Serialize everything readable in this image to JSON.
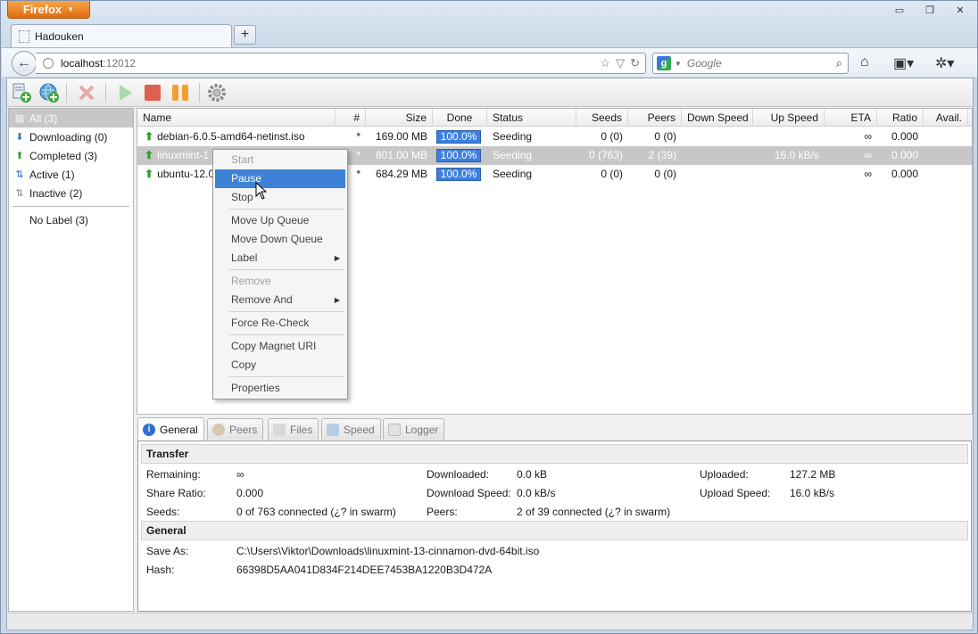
{
  "browser": {
    "menu_button": "Firefox",
    "tab_title": "Hadouken",
    "url_host": "localhost",
    "url_port": ":12012",
    "search_placeholder": "Google"
  },
  "sidebar": {
    "items": [
      {
        "label": "All (3)",
        "icon": "all-icon"
      },
      {
        "label": "Downloading (0)",
        "icon": "down-arrow-icon"
      },
      {
        "label": "Completed (3)",
        "icon": "up-arrow-icon"
      },
      {
        "label": "Active (1)",
        "icon": "active-icon"
      },
      {
        "label": "Inactive (2)",
        "icon": "inactive-icon"
      }
    ],
    "labels": [
      {
        "label": "No Label (3)"
      }
    ]
  },
  "table": {
    "columns": [
      "Name",
      "#",
      "Size",
      "Done",
      "Status",
      "Seeds",
      "Peers",
      "Down Speed",
      "Up Speed",
      "ETA",
      "Ratio",
      "Avail."
    ],
    "rows": [
      {
        "name": "debian-6.0.5-amd64-netinst.iso",
        "queue": "*",
        "size": "169.00 MB",
        "done": "100.0%",
        "status": "Seeding",
        "seeds": "0 (0)",
        "peers": "0 (0)",
        "down": "",
        "up": "",
        "eta": "∞",
        "ratio": "0.000",
        "avail": ""
      },
      {
        "name": "linuxmint-1",
        "queue": "*",
        "size": "801.00 MB",
        "done": "100.0%",
        "status": "Seeding",
        "seeds": "0 (763)",
        "peers": "2 (39)",
        "down": "",
        "up": "16.0 kB/s",
        "eta": "∞",
        "ratio": "0.000",
        "avail": ""
      },
      {
        "name": "ubuntu-12.0",
        "queue": "*",
        "size": "684.29 MB",
        "done": "100.0%",
        "status": "Seeding",
        "seeds": "0 (0)",
        "peers": "0 (0)",
        "down": "",
        "up": "",
        "eta": "∞",
        "ratio": "0.000",
        "avail": ""
      }
    ]
  },
  "context_menu": {
    "start": "Start",
    "pause": "Pause",
    "stop": "Stop",
    "move_up": "Move Up Queue",
    "move_down": "Move Down Queue",
    "label": "Label",
    "remove": "Remove",
    "remove_and": "Remove And",
    "force_recheck": "Force Re-Check",
    "copy_magnet": "Copy Magnet URI",
    "copy": "Copy",
    "properties": "Properties"
  },
  "details": {
    "tabs": [
      "General",
      "Peers",
      "Files",
      "Speed",
      "Logger"
    ],
    "transfer_heading": "Transfer",
    "general_heading": "General",
    "remaining_label": "Remaining:",
    "remaining_value": "∞",
    "share_ratio_label": "Share Ratio:",
    "share_ratio_value": "0.000",
    "seeds_label": "Seeds:",
    "seeds_value": "0 of 763 connected (¿? in swarm)",
    "downloaded_label": "Downloaded:",
    "downloaded_value": "0.0 kB",
    "download_speed_label": "Download Speed:",
    "download_speed_value": "0.0 kB/s",
    "peers_label": "Peers:",
    "peers_value": "2 of 39 connected (¿? in swarm)",
    "uploaded_label": "Uploaded:",
    "uploaded_value": "127.2 MB",
    "upload_speed_label": "Upload Speed:",
    "upload_speed_value": "16.0 kB/s",
    "save_as_label": "Save As:",
    "save_as_value": "C:\\Users\\Viktor\\Downloads\\linuxmint-13-cinnamon-dvd-64bit.iso",
    "hash_label": "Hash:",
    "hash_value": "66398D5AA041D834F214DEE7453BA1220B3D472A"
  },
  "colors": {
    "accent": "#3d82d6",
    "progress": "#3d7fe0",
    "firefox_orange": "#e06d0e",
    "seeding_arrow": "#2ea02e"
  }
}
